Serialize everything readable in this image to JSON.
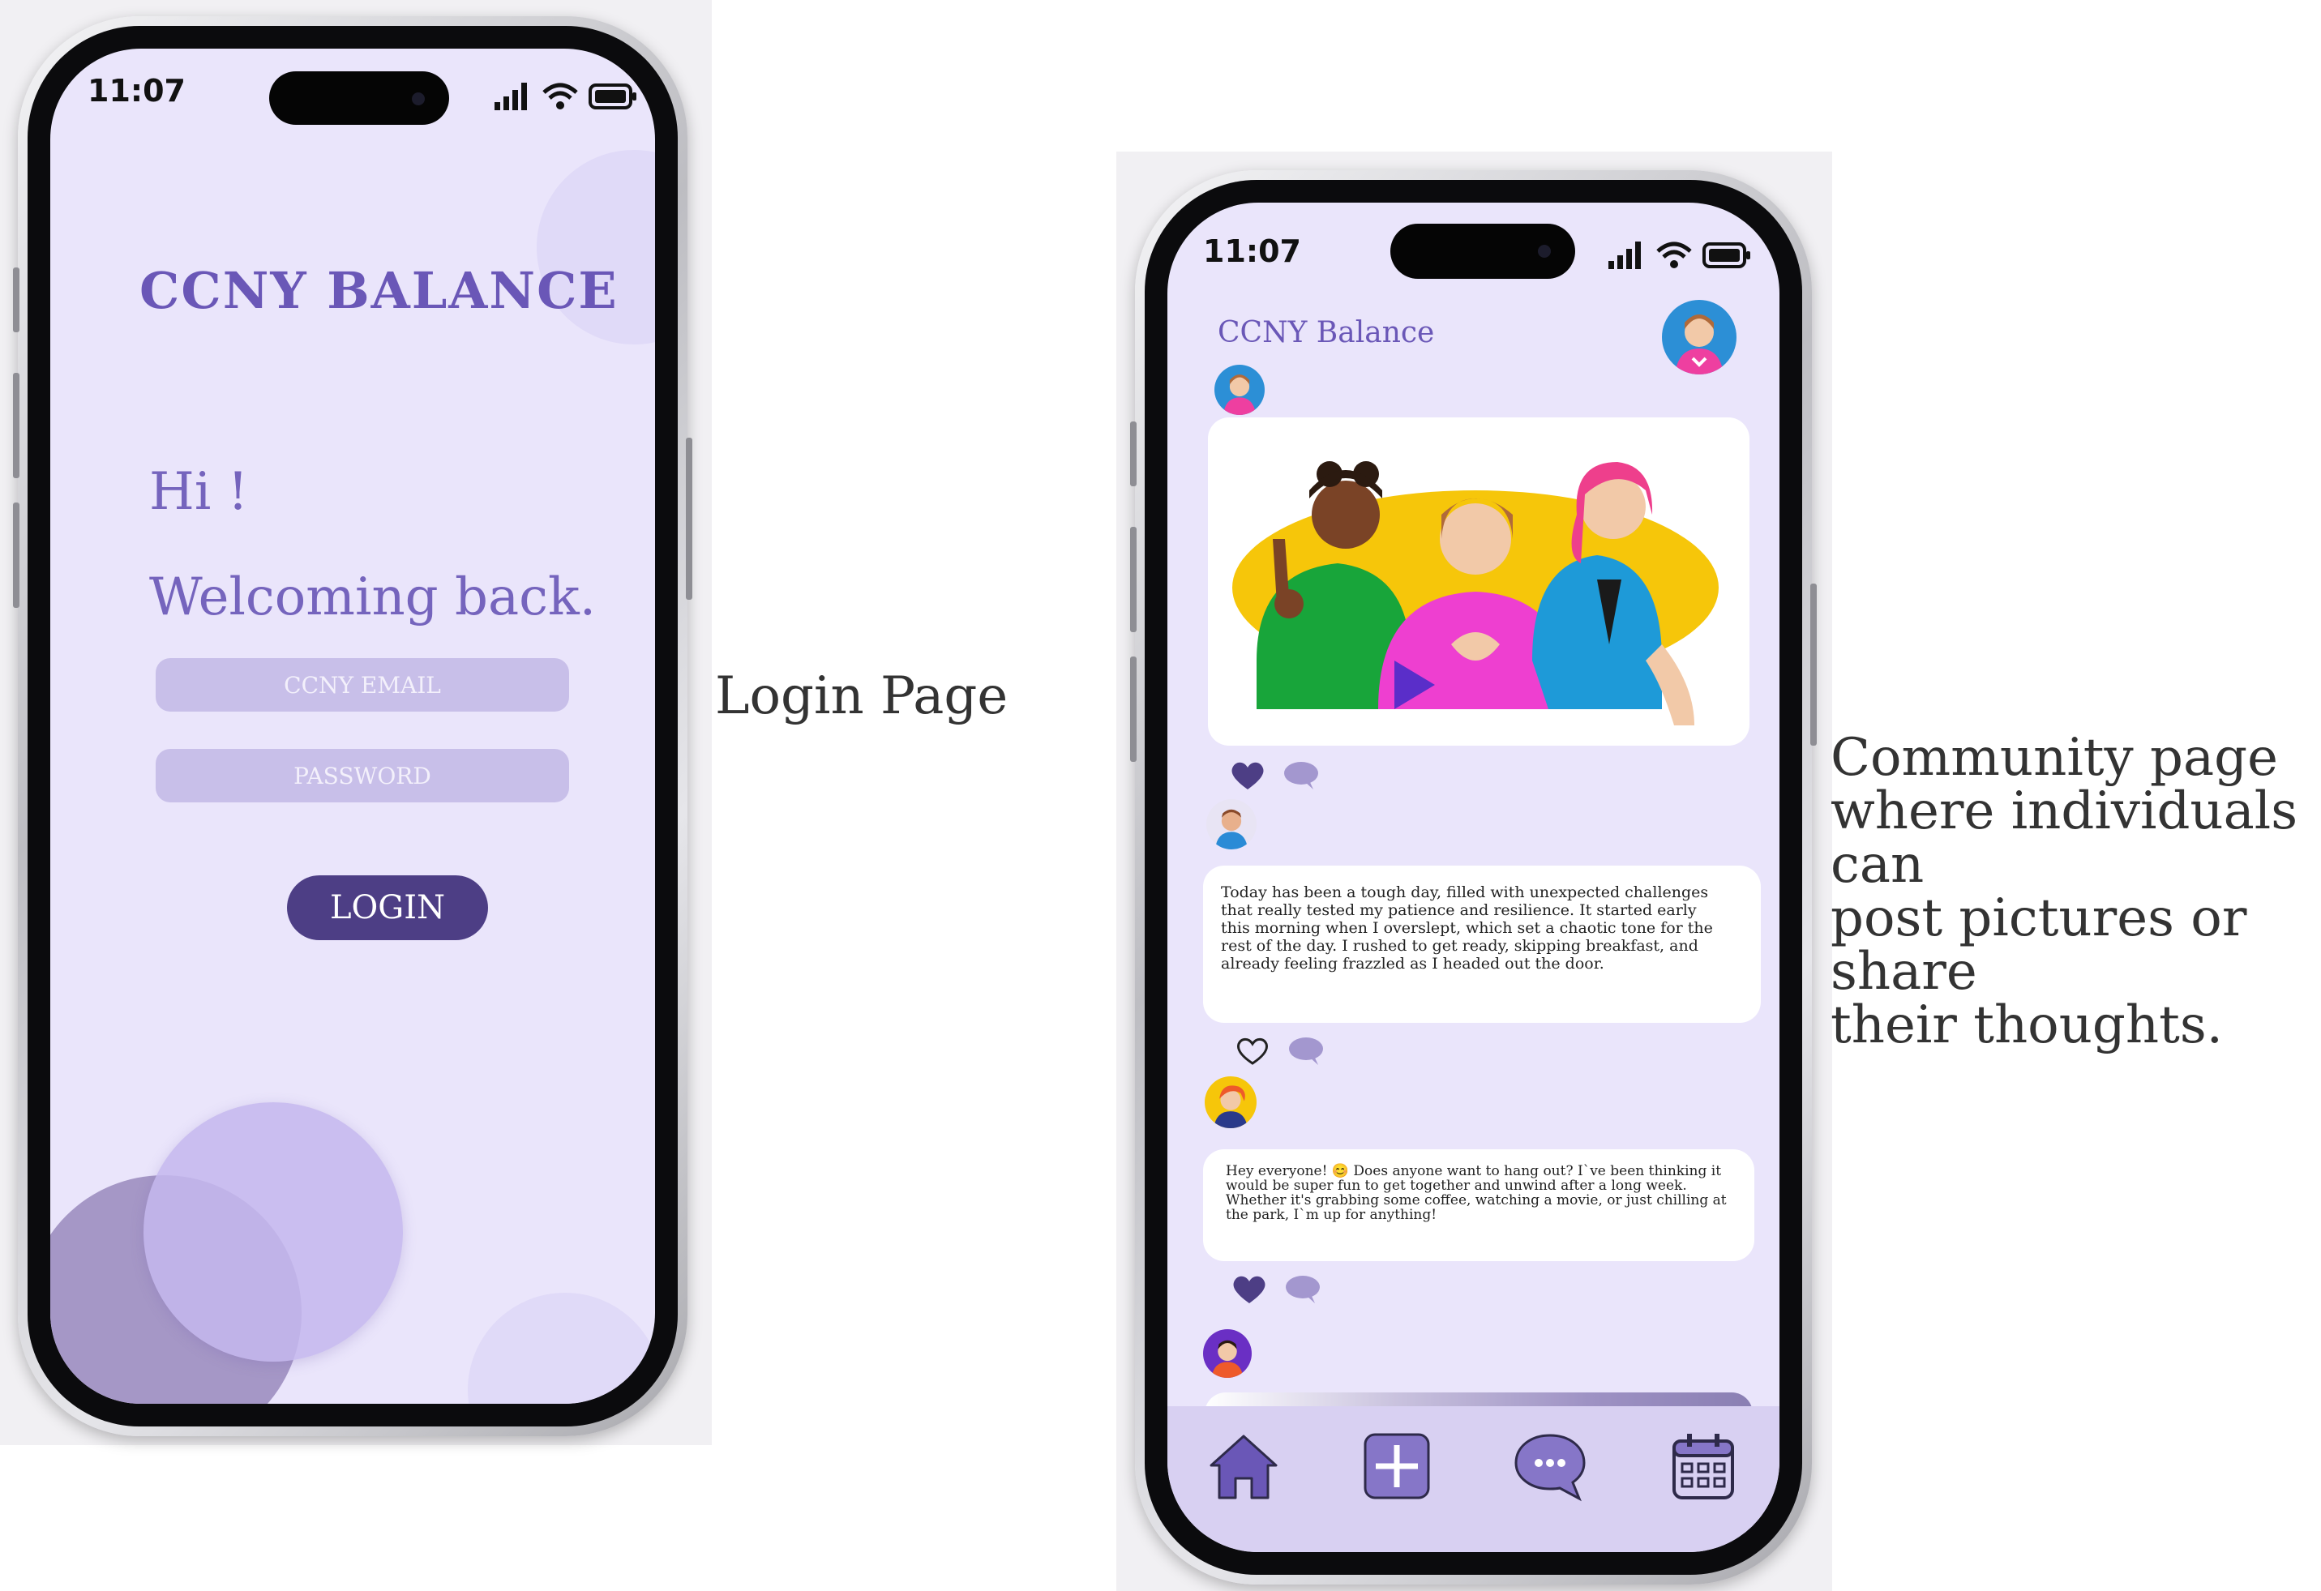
{
  "colors": {
    "screen_bg": "#eae5fb",
    "brand_purple": "#6a57b7",
    "login_button": "#4d3e85",
    "field_bg": "#c8bfe9",
    "nav_bg": "#d8d0f2",
    "reaction_accent": "#5a4a9a"
  },
  "login_page": {
    "status_time": "11:07",
    "app_title": "CCNY BALANCE",
    "greeting": "Hi !",
    "welcome": "Welcoming back.",
    "email_placeholder": "CCNY EMAIL",
    "password_placeholder": "PASSWORD",
    "login_label": "LOGIN",
    "caption": "Login Page"
  },
  "community_page": {
    "status_time": "11:07",
    "app_title": "CCNY Balance",
    "caption_lines": [
      "Community page",
      "where individuals can",
      "post pictures or share",
      "their thoughts."
    ],
    "posts": [
      {
        "type": "image",
        "liked": true
      },
      {
        "type": "text",
        "liked": false,
        "text": "Today has been a tough day, filled with unexpected challenges that really tested my patience and resilience. It started early this morning when I overslept, which set a chaotic tone for the rest of the day. I rushed to get ready, skipping breakfast, and already feeling frazzled as I headed out the door."
      },
      {
        "type": "text",
        "liked": true,
        "text": "Hey everyone! 😊 Does anyone want to hang out? I`ve been thinking it would be super fun to get together and unwind after a long week. Whether it's grabbing some coffee, watching a movie, or just chilling at the park, I`m up for anything!"
      },
      {
        "type": "image-partial"
      }
    ],
    "nav": [
      "home-icon",
      "add-post-icon",
      "chat-icon",
      "calendar-icon"
    ]
  }
}
